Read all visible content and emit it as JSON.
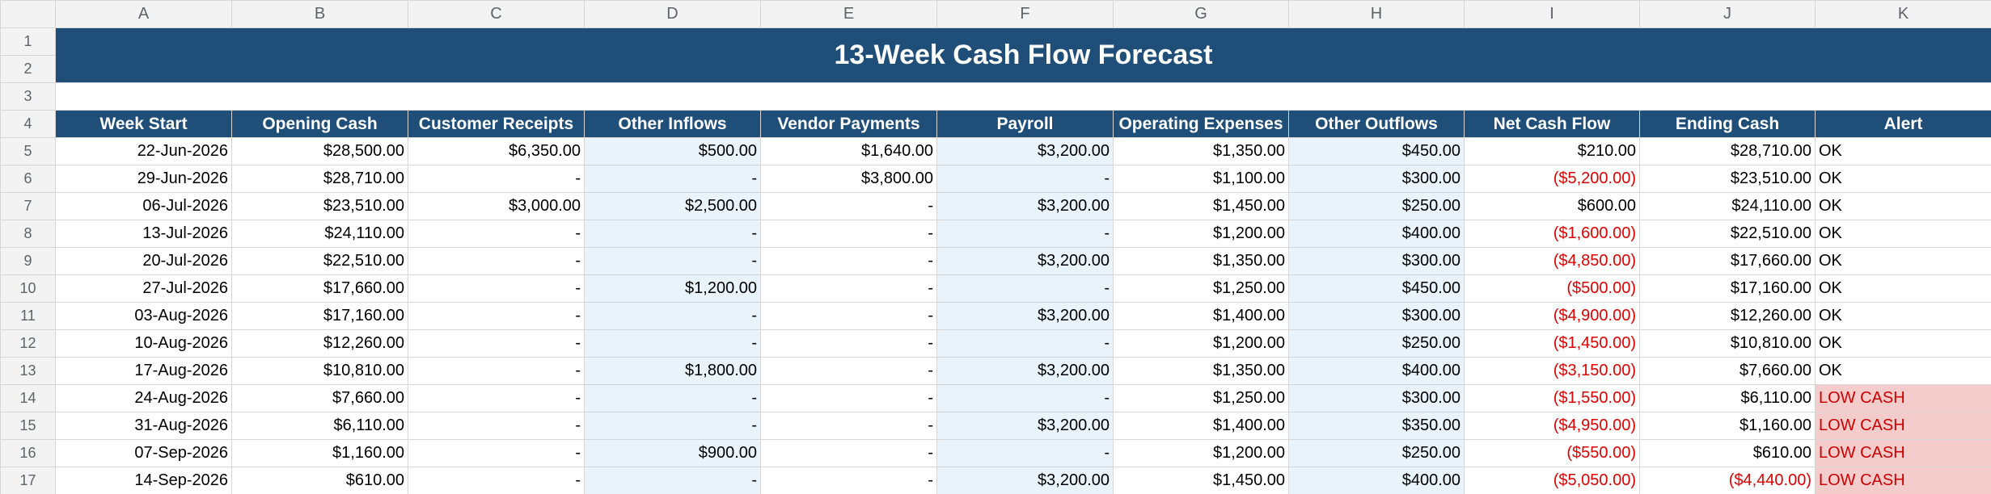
{
  "sheet": {
    "columns": [
      "A",
      "B",
      "C",
      "D",
      "E",
      "F",
      "G",
      "H",
      "I",
      "J",
      "K"
    ],
    "title": "13-Week Cash Flow Forecast",
    "headers": [
      "Week Start",
      "Opening Cash",
      "Customer Receipts",
      "Other Inflows",
      "Vendor Payments",
      "Payroll",
      "Operating Expenses",
      "Other Outflows",
      "Net Cash Flow",
      "Ending Cash",
      "Alert"
    ],
    "row_numbers": [
      "1",
      "2",
      "3",
      "4",
      "5",
      "6",
      "7",
      "8",
      "9",
      "10",
      "11",
      "12",
      "13",
      "14",
      "15",
      "16",
      "17"
    ],
    "rows": [
      [
        "22-Jun-2026",
        "$28,500.00",
        "$6,350.00",
        "$500.00",
        "$1,640.00",
        "$3,200.00",
        "$1,350.00",
        "$450.00",
        "$210.00",
        "$28,710.00",
        "OK"
      ],
      [
        "29-Jun-2026",
        "$28,710.00",
        "-",
        "-",
        "$3,800.00",
        "-",
        "$1,100.00",
        "$300.00",
        "($5,200.00)",
        "$23,510.00",
        "OK"
      ],
      [
        "06-Jul-2026",
        "$23,510.00",
        "$3,000.00",
        "$2,500.00",
        "-",
        "$3,200.00",
        "$1,450.00",
        "$250.00",
        "$600.00",
        "$24,110.00",
        "OK"
      ],
      [
        "13-Jul-2026",
        "$24,110.00",
        "-",
        "-",
        "-",
        "-",
        "$1,200.00",
        "$400.00",
        "($1,600.00)",
        "$22,510.00",
        "OK"
      ],
      [
        "20-Jul-2026",
        "$22,510.00",
        "-",
        "-",
        "-",
        "$3,200.00",
        "$1,350.00",
        "$300.00",
        "($4,850.00)",
        "$17,660.00",
        "OK"
      ],
      [
        "27-Jul-2026",
        "$17,660.00",
        "-",
        "$1,200.00",
        "-",
        "-",
        "$1,250.00",
        "$450.00",
        "($500.00)",
        "$17,160.00",
        "OK"
      ],
      [
        "03-Aug-2026",
        "$17,160.00",
        "-",
        "-",
        "-",
        "$3,200.00",
        "$1,400.00",
        "$300.00",
        "($4,900.00)",
        "$12,260.00",
        "OK"
      ],
      [
        "10-Aug-2026",
        "$12,260.00",
        "-",
        "-",
        "-",
        "-",
        "$1,200.00",
        "$250.00",
        "($1,450.00)",
        "$10,810.00",
        "OK"
      ],
      [
        "17-Aug-2026",
        "$10,810.00",
        "-",
        "$1,800.00",
        "-",
        "$3,200.00",
        "$1,350.00",
        "$400.00",
        "($3,150.00)",
        "$7,660.00",
        "OK"
      ],
      [
        "24-Aug-2026",
        "$7,660.00",
        "-",
        "-",
        "-",
        "-",
        "$1,250.00",
        "$300.00",
        "($1,550.00)",
        "$6,110.00",
        "LOW CASH"
      ],
      [
        "31-Aug-2026",
        "$6,110.00",
        "-",
        "-",
        "-",
        "$3,200.00",
        "$1,400.00",
        "$350.00",
        "($4,950.00)",
        "$1,160.00",
        "LOW CASH"
      ],
      [
        "07-Sep-2026",
        "$1,160.00",
        "-",
        "$900.00",
        "-",
        "-",
        "$1,200.00",
        "$250.00",
        "($550.00)",
        "$610.00",
        "LOW CASH"
      ],
      [
        "14-Sep-2026",
        "$610.00",
        "-",
        "-",
        "-",
        "$3,200.00",
        "$1,450.00",
        "$400.00",
        "($5,050.00)",
        "($4,440.00)",
        "LOW CASH"
      ]
    ]
  },
  "colors": {
    "header_fill": "#1f4e79",
    "header_text": "#ffffff",
    "input_tint": "#e8f3fc",
    "negative_text": "#e00000",
    "alert_fill": "#f4cccc",
    "alert_text": "#cc0000"
  }
}
